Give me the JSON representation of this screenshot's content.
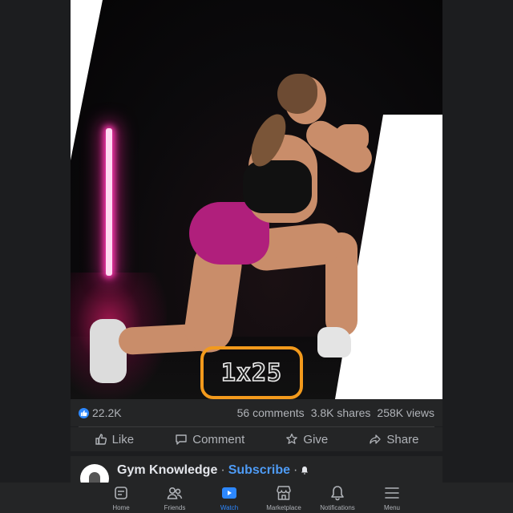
{
  "video": {
    "rep_badge": "1x25"
  },
  "stats": {
    "reactions": "22.2K",
    "comments": "56 comments",
    "shares": "3.8K shares",
    "views": "258K views"
  },
  "actions": {
    "like": "Like",
    "comment": "Comment",
    "give": "Give",
    "share": "Share"
  },
  "next_post": {
    "page_name": "Gym Knowledge",
    "separator": "·",
    "subscribe": "Subscribe",
    "separator2": "·"
  },
  "bottom_nav": {
    "items": [
      {
        "label": "Home",
        "icon": "home-icon"
      },
      {
        "label": "Friends",
        "icon": "friends-icon"
      },
      {
        "label": "Watch",
        "icon": "watch-icon"
      },
      {
        "label": "Marketplace",
        "icon": "marketplace-icon"
      },
      {
        "label": "Notifications",
        "icon": "bell-icon"
      },
      {
        "label": "Menu",
        "icon": "menu-icon"
      }
    ],
    "active": "Watch"
  },
  "colors": {
    "accent": "#2d88ff",
    "badge_border": "#f39a1c",
    "shorts": "#b01f7c",
    "neon": "#ff3ab2",
    "panel": "#242526",
    "background": "#1c1d1f"
  }
}
